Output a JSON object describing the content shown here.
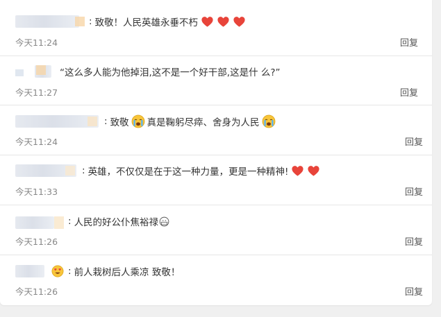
{
  "comments": [
    {
      "text": "致敬！人民英雄永垂不朽",
      "time": "今天11:24",
      "reply": "回复",
      "hearts": 3
    },
    {
      "text": "“这么多人能为他掉泪,这不是一个好干部,这是什 么?”",
      "time": "今天11:27",
      "reply": "回复"
    },
    {
      "text_a": "致敬",
      "text_b": "真是鞠躬尽瘁、舍身为人民",
      "time": "今天11:24",
      "reply": "回复"
    },
    {
      "text": "英雄，不仅仅是在于这一种力量，更是一种精神!",
      "time": "今天11:33",
      "reply": "回复",
      "hearts": 2
    },
    {
      "text": "人民的好公仆焦裕禄",
      "time": "今天11:26",
      "reply": "回复"
    },
    {
      "text": "前人栽树后人乘凉 致敬！",
      "time": "今天11:26",
      "reply": "回复"
    }
  ],
  "colors": {
    "heart": "#e8443a",
    "time": "#888888",
    "divider": "#e6e6e6"
  },
  "icons": [
    "heart-icon",
    "crying-face-icon",
    "mask-face-icon",
    "heart-eyes-face-icon"
  ]
}
